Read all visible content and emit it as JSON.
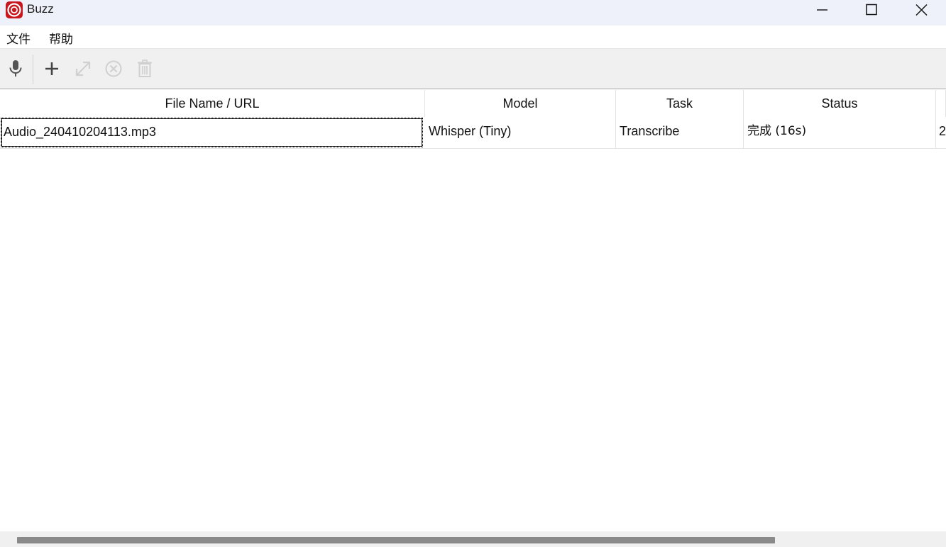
{
  "window": {
    "title": "Buzz",
    "app_icon": "buzz-logo-icon",
    "controls": [
      "minimize-icon",
      "maximize-icon",
      "close-icon"
    ]
  },
  "menu": {
    "items": [
      {
        "label": "文件"
      },
      {
        "label": "帮助"
      }
    ]
  },
  "toolbar": {
    "buttons": [
      {
        "icon": "microphone-icon",
        "enabled": true
      },
      {
        "icon": "plus-icon",
        "enabled": true
      },
      {
        "icon": "expand-icon",
        "enabled": false
      },
      {
        "icon": "cancel-circle-icon",
        "enabled": false
      },
      {
        "icon": "trash-icon",
        "enabled": false
      }
    ]
  },
  "table": {
    "columns": [
      "File Name / URL",
      "Model",
      "Task",
      "Status",
      ""
    ],
    "rows": [
      {
        "file": "Audio_240410204113.mp3",
        "model": "Whisper (Tiny)",
        "task": "Transcribe",
        "status": "完成 (16s)",
        "extra": "2"
      }
    ]
  },
  "colors": {
    "titlebar": "#eef1f9",
    "toolbar": "#f0f0f0",
    "accent": "#c8171e"
  }
}
